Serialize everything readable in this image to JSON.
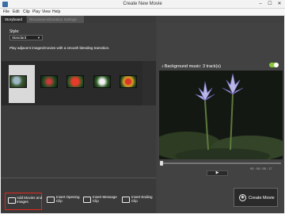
{
  "window": {
    "title": "Create New Movie",
    "min": "–",
    "max": "☐",
    "close": "✕"
  },
  "menu": [
    "File",
    "Edit",
    "Clip",
    "Play",
    "View",
    "Help"
  ],
  "tabs": {
    "storyboard": "Storyboard",
    "decoration": "Decorations/Duration Settings"
  },
  "style": {
    "label": "Style:",
    "selected": "Standard",
    "description": "Play adjacent images/movies with a smooth blending transition."
  },
  "bottom_buttons": {
    "add": "Add Movies and Images",
    "opening": "Insert Opening Clip",
    "message": "Insert Message Clip",
    "ending": "Insert Ending Clip"
  },
  "player": {
    "bgm_label": "Background music: 3 track(s)",
    "time": "00 : 00 / 00 : 17",
    "play_icon": "▶"
  },
  "create": {
    "label": "Create Movie",
    "icon": "film-reel-icon"
  },
  "colors": {
    "highlight_border": "#e0281e",
    "toggle_on": "#8ac43b"
  }
}
